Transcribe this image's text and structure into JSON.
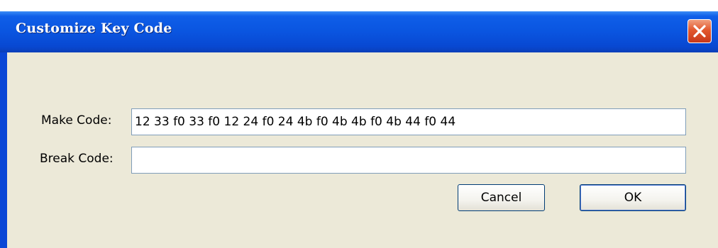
{
  "window": {
    "title": "Customize Key Code"
  },
  "form": {
    "make_code_label": "Make Code:",
    "make_code_value": "12 33 f0 33 f0 12 24 f0 24 4b f0 4b 4b f0 4b 44 f0 44",
    "break_code_label": "Break Code:",
    "break_code_value": ""
  },
  "buttons": {
    "cancel_label": "Cancel",
    "ok_label": "OK"
  },
  "icons": {
    "close": "close-icon"
  }
}
